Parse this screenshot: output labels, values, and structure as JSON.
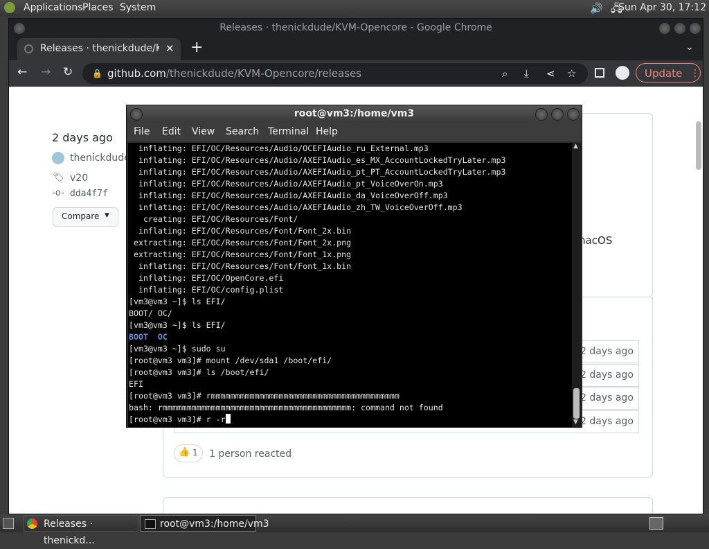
{
  "top_panel": {
    "menus": [
      "Applications",
      "Places",
      "System"
    ],
    "clock": "Sun Apr 30, 17:12"
  },
  "chrome": {
    "window_title": "Releases · thenickdude/KVM-Opencore - Google Chrome",
    "tab_title": "Releases · thenickdude/KVM-",
    "url_host": "github.com",
    "url_path": "/thenickdude/KVM-Opencore/releases",
    "update_label": "Update"
  },
  "github": {
    "time_ago": "2 days ago",
    "author": "thenickdude",
    "tag": "v20",
    "commit": "dda4f7f",
    "compare_label": "Compare",
    "macos_fragment": "macOS",
    "asset_dates": [
      "2 days ago",
      "2 days ago",
      "2 days ago",
      "2 days ago"
    ],
    "reaction_count": "1",
    "reaction_text": "1 person reacted"
  },
  "terminal": {
    "title": "root@vm3:/home/vm3",
    "menu": [
      "File",
      "Edit",
      "View",
      "Search",
      "Terminal",
      "Help"
    ],
    "lines": [
      "  inflating: EFI/OC/Resources/Audio/OCEFIAudio_ru_External.mp3",
      "  inflating: EFI/OC/Resources/Audio/AXEFIAudio_es_MX_AccountLockedTryLater.mp3",
      "  inflating: EFI/OC/Resources/Audio/AXEFIAudio_pt_PT_AccountLockedTryLater.mp3",
      "  inflating: EFI/OC/Resources/Audio/AXEFIAudio_pt_VoiceOverOn.mp3",
      "  inflating: EFI/OC/Resources/Audio/AXEFIAudio_da_VoiceOverOff.mp3",
      "  inflating: EFI/OC/Resources/Audio/AXEFIAudio_zh_TW_VoiceOverOff.mp3",
      "   creating: EFI/OC/Resources/Font/",
      "  inflating: EFI/OC/Resources/Font/Font_2x.bin",
      " extracting: EFI/OC/Resources/Font/Font_2x.png",
      " extracting: EFI/OC/Resources/Font/Font_1x.png",
      "  inflating: EFI/OC/Resources/Font/Font_1x.bin",
      "  inflating: EFI/OC/OpenCore.efi",
      "  inflating: EFI/OC/config.plist",
      "[vm3@vm3 ~]$ ls EFI/",
      "BOOT/ OC/",
      "[vm3@vm3 ~]$ ls EFI/"
    ],
    "ls_dirs": [
      "BOOT",
      "OC"
    ],
    "lines2": [
      "[vm3@vm3 ~]$ sudo su",
      "[root@vm3 vm3]# mount /dev/sda1 /boot/efi/",
      "[root@vm3 vm3]# ls /boot/efi/",
      "EFI",
      "[root@vm3 vm3]# rmmmmmmmmmmmmmmmmmmmmmmmmmmmmmmmmmmmmmmm",
      "bash: rmmmmmmmmmmmmmmmmmmmmmmmmmmmmmmmmmmmmmmm: command not found"
    ],
    "prompt": "[root@vm3 vm3]# r -r"
  },
  "taskbar": {
    "chrome_task": "Releases · thenickd...",
    "terminal_task": "root@vm3:/home/vm3"
  }
}
